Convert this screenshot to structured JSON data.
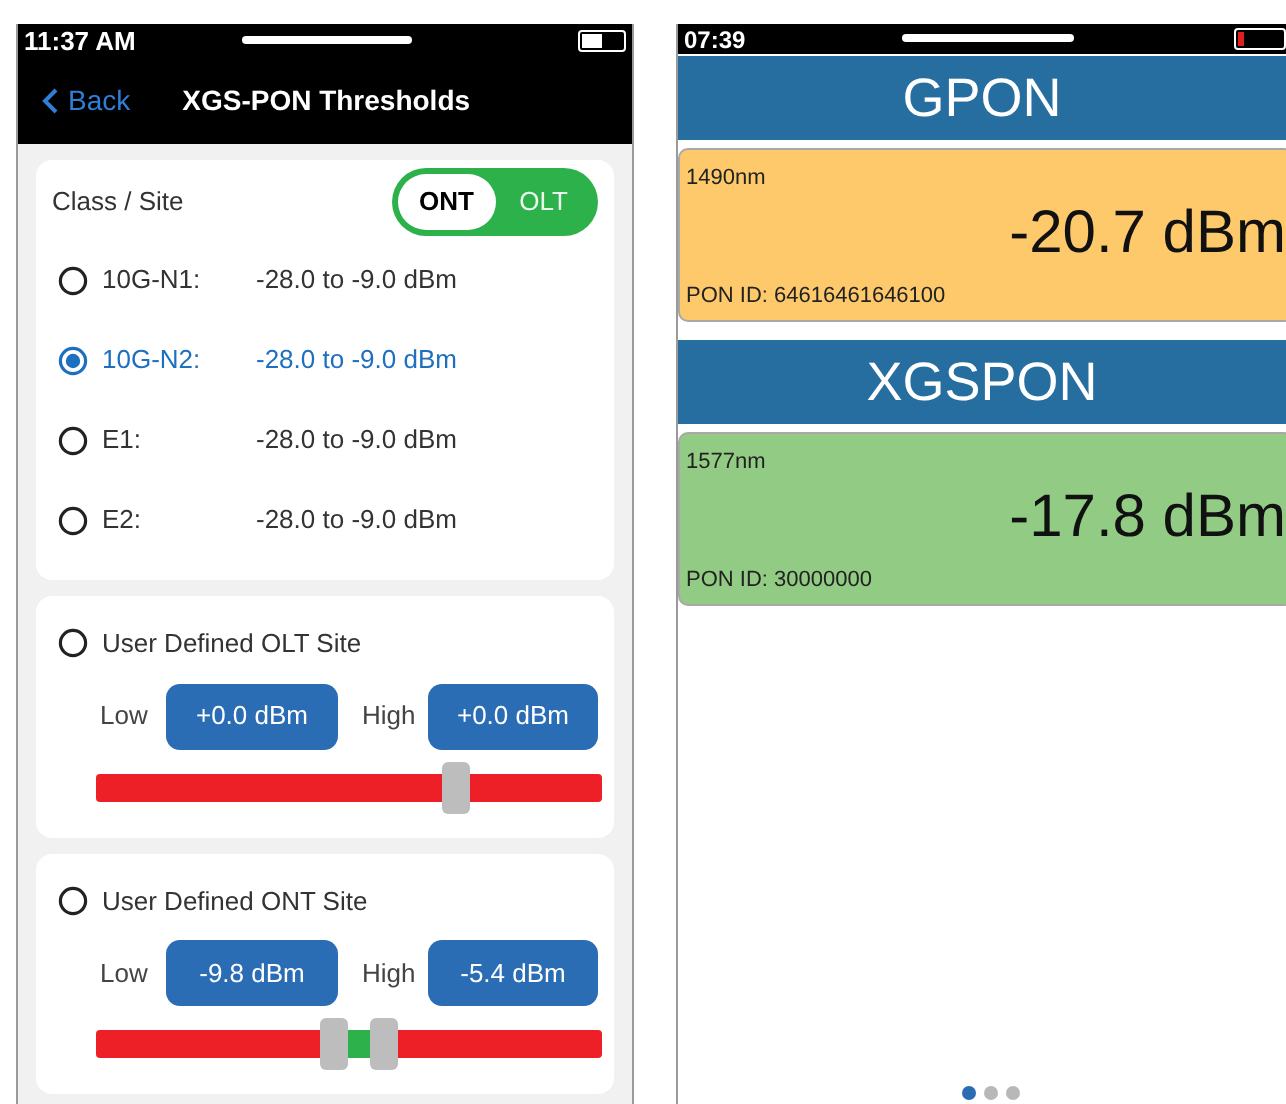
{
  "left_screen": {
    "status_bar": {
      "time": "11:37 AM"
    },
    "nav": {
      "back": "Back",
      "title": "XGS-PON Thresholds"
    },
    "class_site": {
      "label": "Class / Site",
      "toggle": [
        {
          "label": "ONT",
          "selected": true
        },
        {
          "label": "OLT",
          "selected": false
        }
      ],
      "options": [
        {
          "name": "10G-N1:",
          "range": "-28.0 to -9.0 dBm",
          "selected": false
        },
        {
          "name": "10G-N2:",
          "range": "-28.0 to -9.0 dBm",
          "selected": true
        },
        {
          "name": "E1:",
          "range": "-28.0 to -9.0 dBm",
          "selected": false
        },
        {
          "name": "E2:",
          "range": "-28.0 to -9.0 dBm",
          "selected": false
        }
      ]
    },
    "user_defined": [
      {
        "label": "User Defined OLT Site",
        "selected": false,
        "low_label": "Low",
        "low": "+0.0 dBm",
        "high_label": "High",
        "high": "+0.0 dBm",
        "thumbs": [
          {
            "level": 0.71
          }
        ]
      },
      {
        "label": "User Defined ONT Site",
        "selected": false,
        "low_label": "Low",
        "low": "-9.8 dBm",
        "high_label": "High",
        "high": "-5.4 dBm",
        "thumbs": [
          {
            "level": 0.47
          },
          {
            "level": 0.57
          }
        ]
      }
    ]
  },
  "right_screen": {
    "status_bar": {
      "time": "07:39"
    },
    "sections": [
      {
        "header": "GPON",
        "wavelength": "1490nm",
        "power": "-20.7 dBm",
        "pon_id": "PON ID: 64616461646100",
        "color": "#fdc96b"
      },
      {
        "header": "XGSPON",
        "wavelength": "1577nm",
        "power": "-17.8 dBm",
        "pon_id": "PON ID: 30000000",
        "color": "#92cc84"
      }
    ],
    "page_dots": [
      {
        "selected": true
      },
      {
        "selected": false
      },
      {
        "selected": false
      }
    ]
  }
}
